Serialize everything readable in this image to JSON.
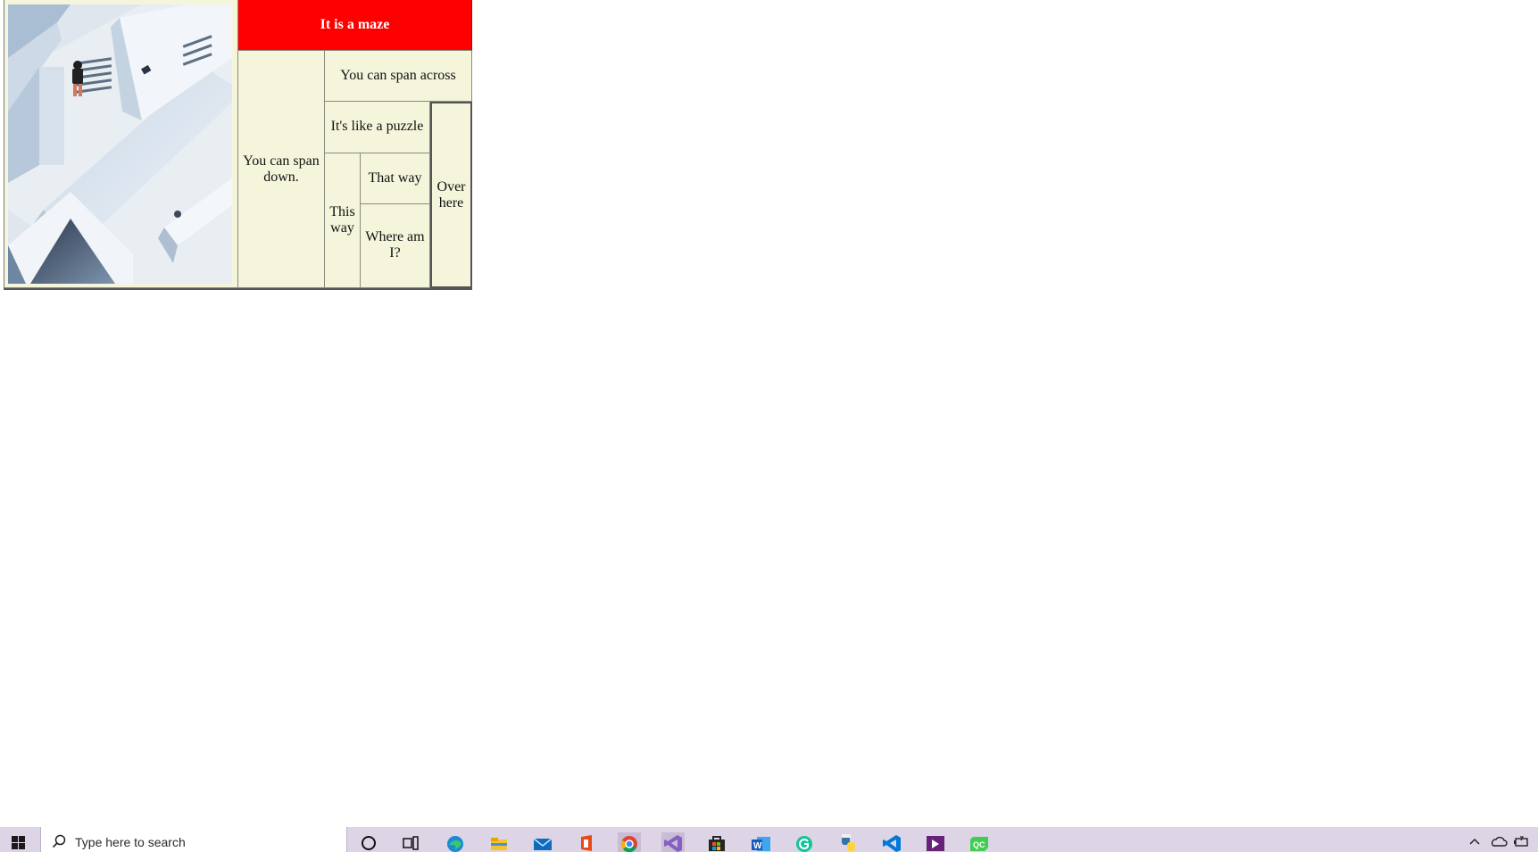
{
  "maze_table": {
    "title": "It is a maze",
    "span_down": "You can span down.",
    "span_across": "You can span across",
    "puzzle": "It's like a puzzle",
    "this_way": "This way",
    "that_way": "That way",
    "where_am_i": "Where am I?",
    "over_here": "Over here",
    "colors": {
      "title_bg": "#ff0000",
      "cell_bg": "#f5f5dc"
    }
  },
  "taskbar": {
    "search_placeholder": "Type here to search",
    "pinned_icons": [
      "cortana-icon",
      "task-view-icon",
      "edge-icon",
      "file-explorer-icon",
      "mail-icon",
      "office-icon",
      "chrome-icon",
      "visual-studio-icon",
      "store-icon",
      "word-icon",
      "grammarly-icon",
      "python-icon",
      "vscode-icon",
      "visual-studio-preview-icon",
      "qt-creator-icon"
    ],
    "tray_icons": [
      "chevron-up-icon",
      "onedrive-icon",
      "battery-icon"
    ]
  }
}
